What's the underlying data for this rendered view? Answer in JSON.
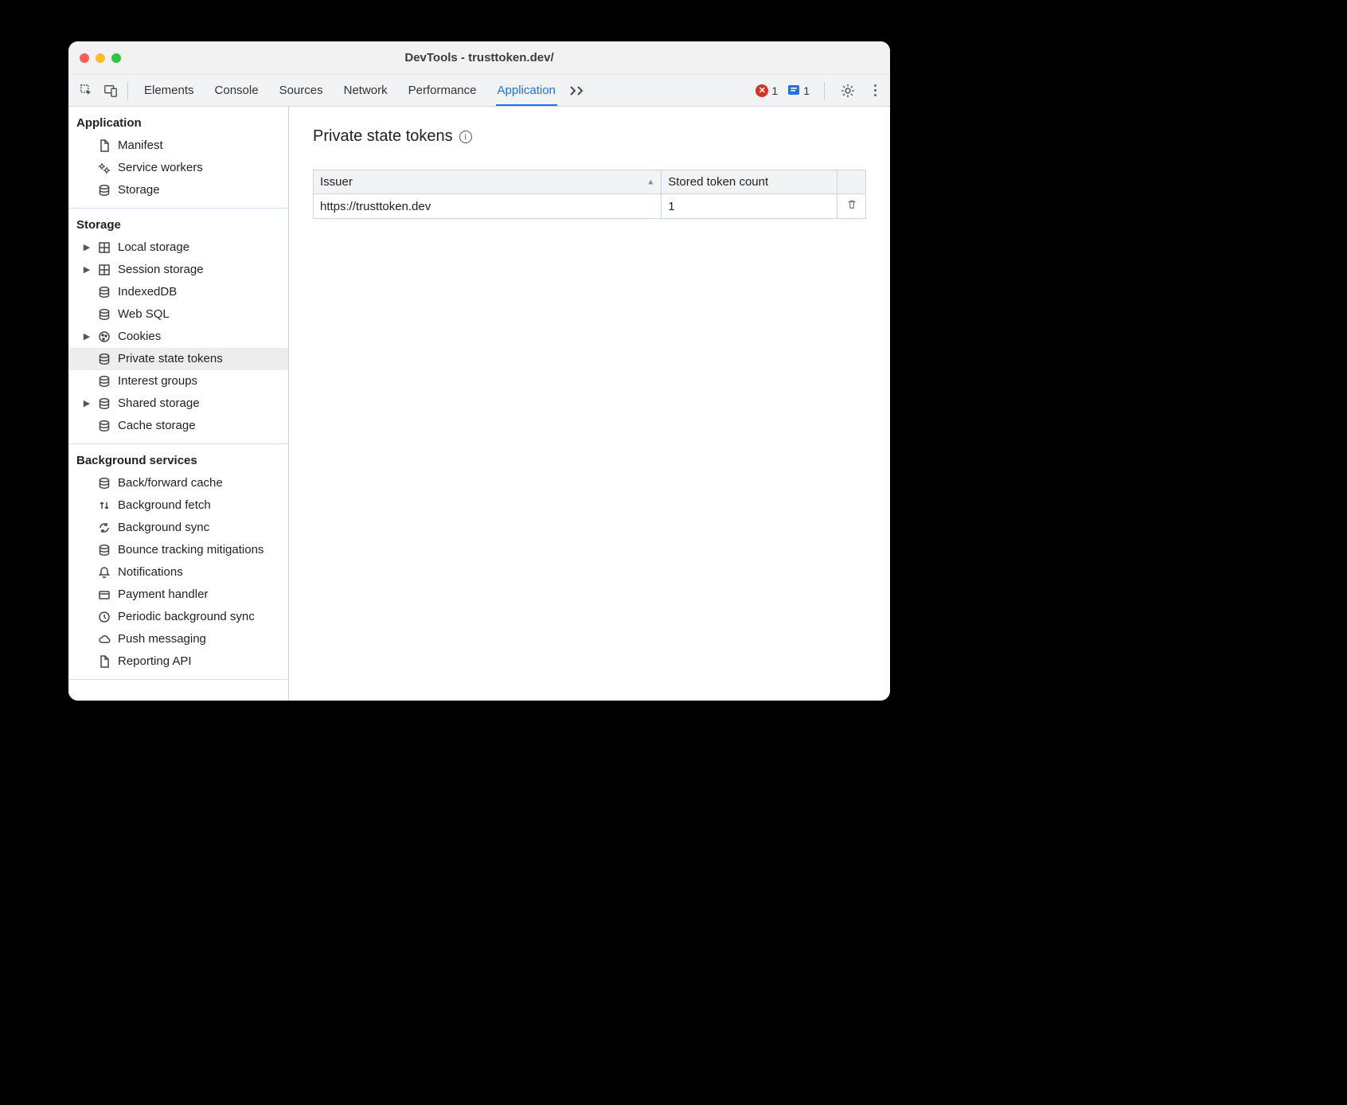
{
  "window": {
    "title": "DevTools - trusttoken.dev/"
  },
  "toolbar": {
    "tabs": [
      {
        "label": "Elements",
        "active": false
      },
      {
        "label": "Console",
        "active": false
      },
      {
        "label": "Sources",
        "active": false
      },
      {
        "label": "Network",
        "active": false
      },
      {
        "label": "Performance",
        "active": false
      },
      {
        "label": "Application",
        "active": true
      }
    ],
    "error_count": "1",
    "info_count": "1"
  },
  "sidebar": {
    "sections": [
      {
        "title": "Application",
        "items": [
          {
            "icon": "file-icon",
            "label": "Manifest",
            "arrow": false
          },
          {
            "icon": "gears-icon",
            "label": "Service workers",
            "arrow": false
          },
          {
            "icon": "database-icon",
            "label": "Storage",
            "arrow": false
          }
        ]
      },
      {
        "title": "Storage",
        "items": [
          {
            "icon": "table-icon",
            "label": "Local storage",
            "arrow": true
          },
          {
            "icon": "table-icon",
            "label": "Session storage",
            "arrow": true
          },
          {
            "icon": "database-icon",
            "label": "IndexedDB",
            "arrow": false
          },
          {
            "icon": "database-icon",
            "label": "Web SQL",
            "arrow": false
          },
          {
            "icon": "cookie-icon",
            "label": "Cookies",
            "arrow": true
          },
          {
            "icon": "database-icon",
            "label": "Private state tokens",
            "arrow": false,
            "selected": true
          },
          {
            "icon": "database-icon",
            "label": "Interest groups",
            "arrow": false
          },
          {
            "icon": "database-icon",
            "label": "Shared storage",
            "arrow": true
          },
          {
            "icon": "database-icon",
            "label": "Cache storage",
            "arrow": false
          }
        ]
      },
      {
        "title": "Background services",
        "items": [
          {
            "icon": "database-icon",
            "label": "Back/forward cache",
            "arrow": false
          },
          {
            "icon": "updown-icon",
            "label": "Background fetch",
            "arrow": false
          },
          {
            "icon": "sync-icon",
            "label": "Background sync",
            "arrow": false
          },
          {
            "icon": "database-icon",
            "label": "Bounce tracking mitigations",
            "arrow": false
          },
          {
            "icon": "bell-icon",
            "label": "Notifications",
            "arrow": false
          },
          {
            "icon": "card-icon",
            "label": "Payment handler",
            "arrow": false
          },
          {
            "icon": "clock-icon",
            "label": "Periodic background sync",
            "arrow": false
          },
          {
            "icon": "cloud-icon",
            "label": "Push messaging",
            "arrow": false
          },
          {
            "icon": "file-icon",
            "label": "Reporting API",
            "arrow": false
          }
        ]
      }
    ]
  },
  "main": {
    "heading": "Private state tokens",
    "columns": [
      "Issuer",
      "Stored token count"
    ],
    "rows": [
      {
        "issuer": "https://trusttoken.dev",
        "count": "1"
      }
    ]
  }
}
